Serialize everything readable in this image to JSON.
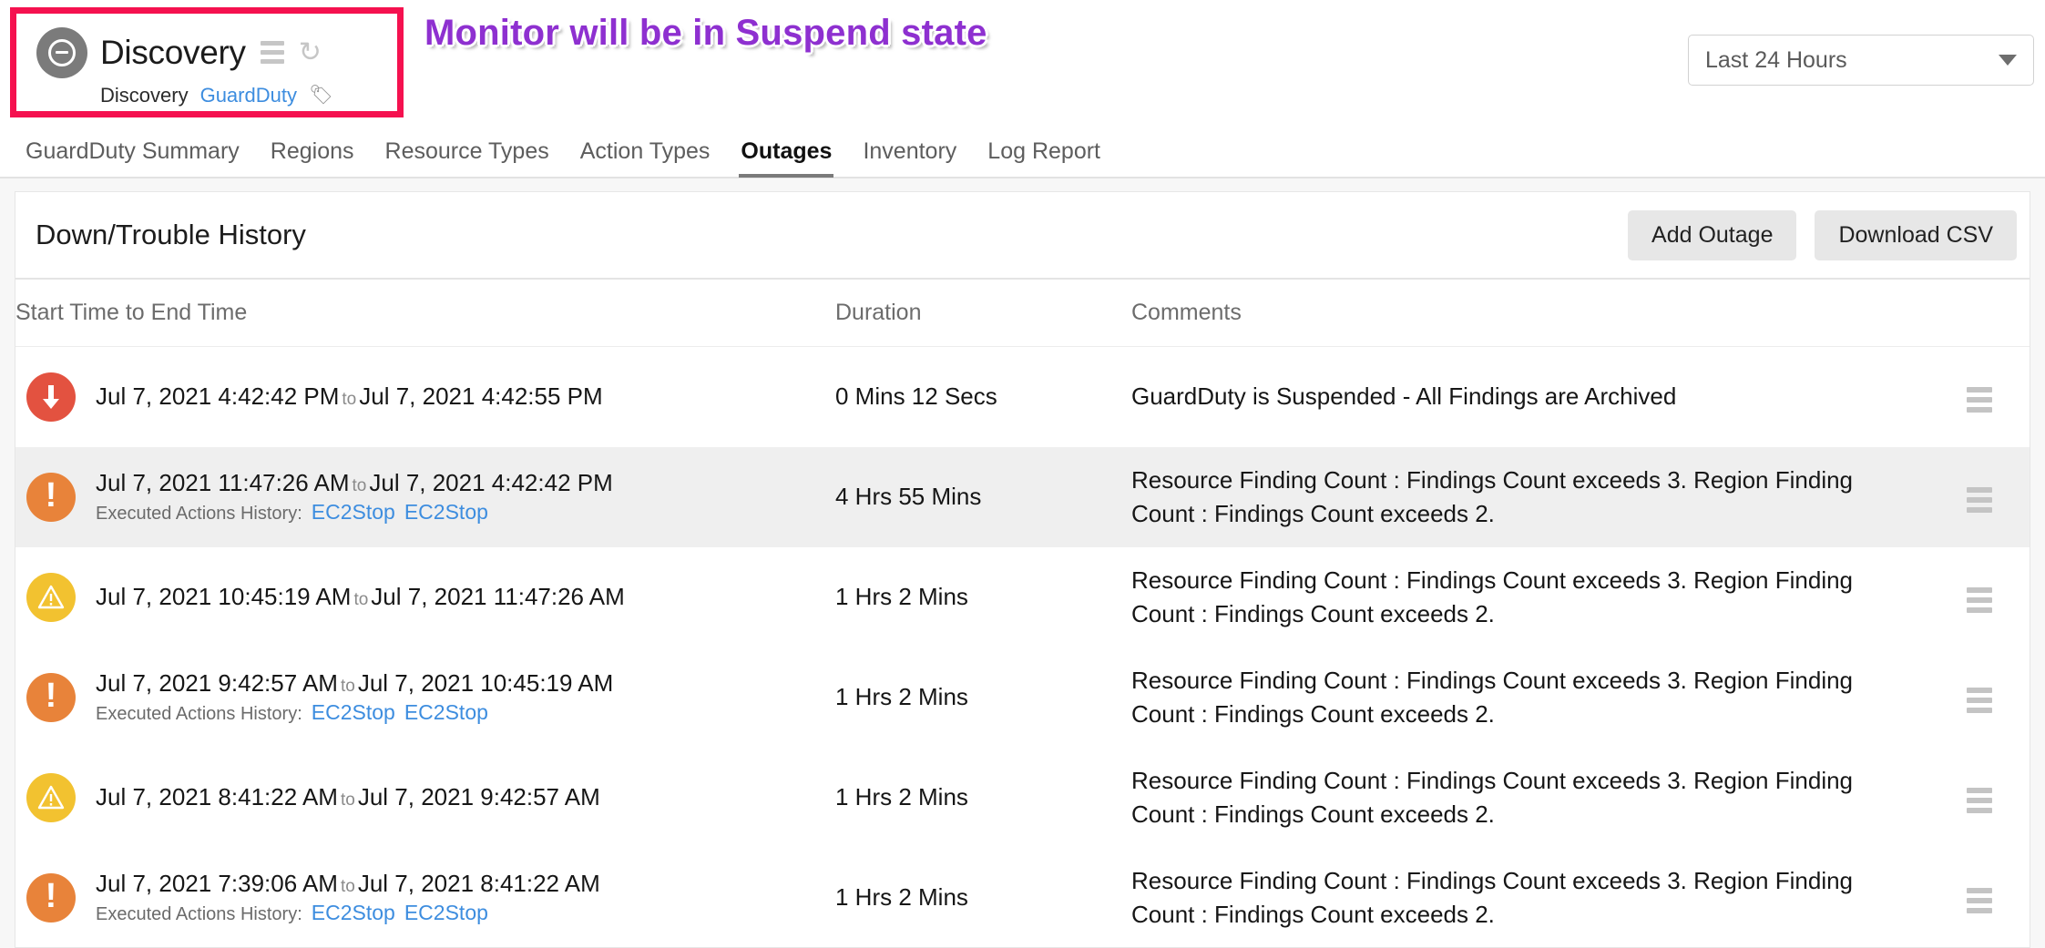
{
  "monitor": {
    "title": "Discovery",
    "status_icon": "minus-circle-icon",
    "menu_icon": "hamburger-icon",
    "refresh_icon": "refresh-icon",
    "subtype": "Discovery",
    "service_link": "GuardDuty",
    "tag_icon": "tag-icon"
  },
  "annotation": {
    "text": "Monitor will be in Suspend state",
    "color": "#8e30d0",
    "highlight_border_color": "#f5114f"
  },
  "time_range": {
    "selected": "Last 24 Hours",
    "caret_icon": "chevron-down-icon"
  },
  "nav": {
    "tabs": [
      {
        "label": "GuardDuty Summary",
        "active": false
      },
      {
        "label": "Regions",
        "active": false
      },
      {
        "label": "Resource Types",
        "active": false
      },
      {
        "label": "Action Types",
        "active": false
      },
      {
        "label": "Outages",
        "active": true
      },
      {
        "label": "Inventory",
        "active": false
      },
      {
        "label": "Log Report",
        "active": false
      }
    ]
  },
  "panel": {
    "title": "Down/Trouble History",
    "add_outage_label": "Add Outage",
    "download_csv_label": "Download CSV"
  },
  "table": {
    "columns": [
      "Start Time to End Time",
      "Duration",
      "Comments",
      ""
    ],
    "actions_label": "Executed Actions History:",
    "to_label": "to",
    "row_menu_icon": "hamburger-icon",
    "rows": [
      {
        "severity": "down",
        "severity_icon": "down-arrow-icon",
        "severity_color": "#e35240",
        "start": "Jul 7, 2021 4:42:42 PM",
        "end": "Jul 7, 2021 4:42:55 PM",
        "duration": "0 Mins 12 Secs",
        "comment": "GuardDuty is Suspended - All Findings are Archived",
        "actions": [],
        "striped": false
      },
      {
        "severity": "trouble",
        "severity_icon": "exclamation-icon",
        "severity_color": "#e8833a",
        "start": "Jul 7, 2021 11:47:26 AM",
        "end": "Jul 7, 2021 4:42:42 PM",
        "duration": "4 Hrs 55 Mins",
        "comment": "Resource Finding Count : Findings Count exceeds 3. Region Finding Count : Findings Count exceeds 2.",
        "actions": [
          "EC2Stop",
          "EC2Stop"
        ],
        "striped": true
      },
      {
        "severity": "warning",
        "severity_icon": "warning-triangle-icon",
        "severity_color": "#f2c230",
        "start": "Jul 7, 2021 10:45:19 AM",
        "end": "Jul 7, 2021 11:47:26 AM",
        "duration": "1 Hrs 2 Mins",
        "comment": "Resource Finding Count : Findings Count exceeds 3. Region Finding Count : Findings Count exceeds 2.",
        "actions": [],
        "striped": false
      },
      {
        "severity": "trouble",
        "severity_icon": "exclamation-icon",
        "severity_color": "#e8833a",
        "start": "Jul 7, 2021 9:42:57 AM",
        "end": "Jul 7, 2021 10:45:19 AM",
        "duration": "1 Hrs 2 Mins",
        "comment": "Resource Finding Count : Findings Count exceeds 3. Region Finding Count : Findings Count exceeds 2.",
        "actions": [
          "EC2Stop",
          "EC2Stop"
        ],
        "striped": false
      },
      {
        "severity": "warning",
        "severity_icon": "warning-triangle-icon",
        "severity_color": "#f2c230",
        "start": "Jul 7, 2021 8:41:22 AM",
        "end": "Jul 7, 2021 9:42:57 AM",
        "duration": "1 Hrs 2 Mins",
        "comment": "Resource Finding Count : Findings Count exceeds 3. Region Finding Count : Findings Count exceeds 2.",
        "actions": [],
        "striped": false
      },
      {
        "severity": "trouble",
        "severity_icon": "exclamation-icon",
        "severity_color": "#e8833a",
        "start": "Jul 7, 2021 7:39:06 AM",
        "end": "Jul 7, 2021 8:41:22 AM",
        "duration": "1 Hrs 2 Mins",
        "comment": "Resource Finding Count : Findings Count exceeds 3. Region Finding Count : Findings Count exceeds 2.",
        "actions": [
          "EC2Stop",
          "EC2Stop"
        ],
        "striped": false
      }
    ]
  }
}
